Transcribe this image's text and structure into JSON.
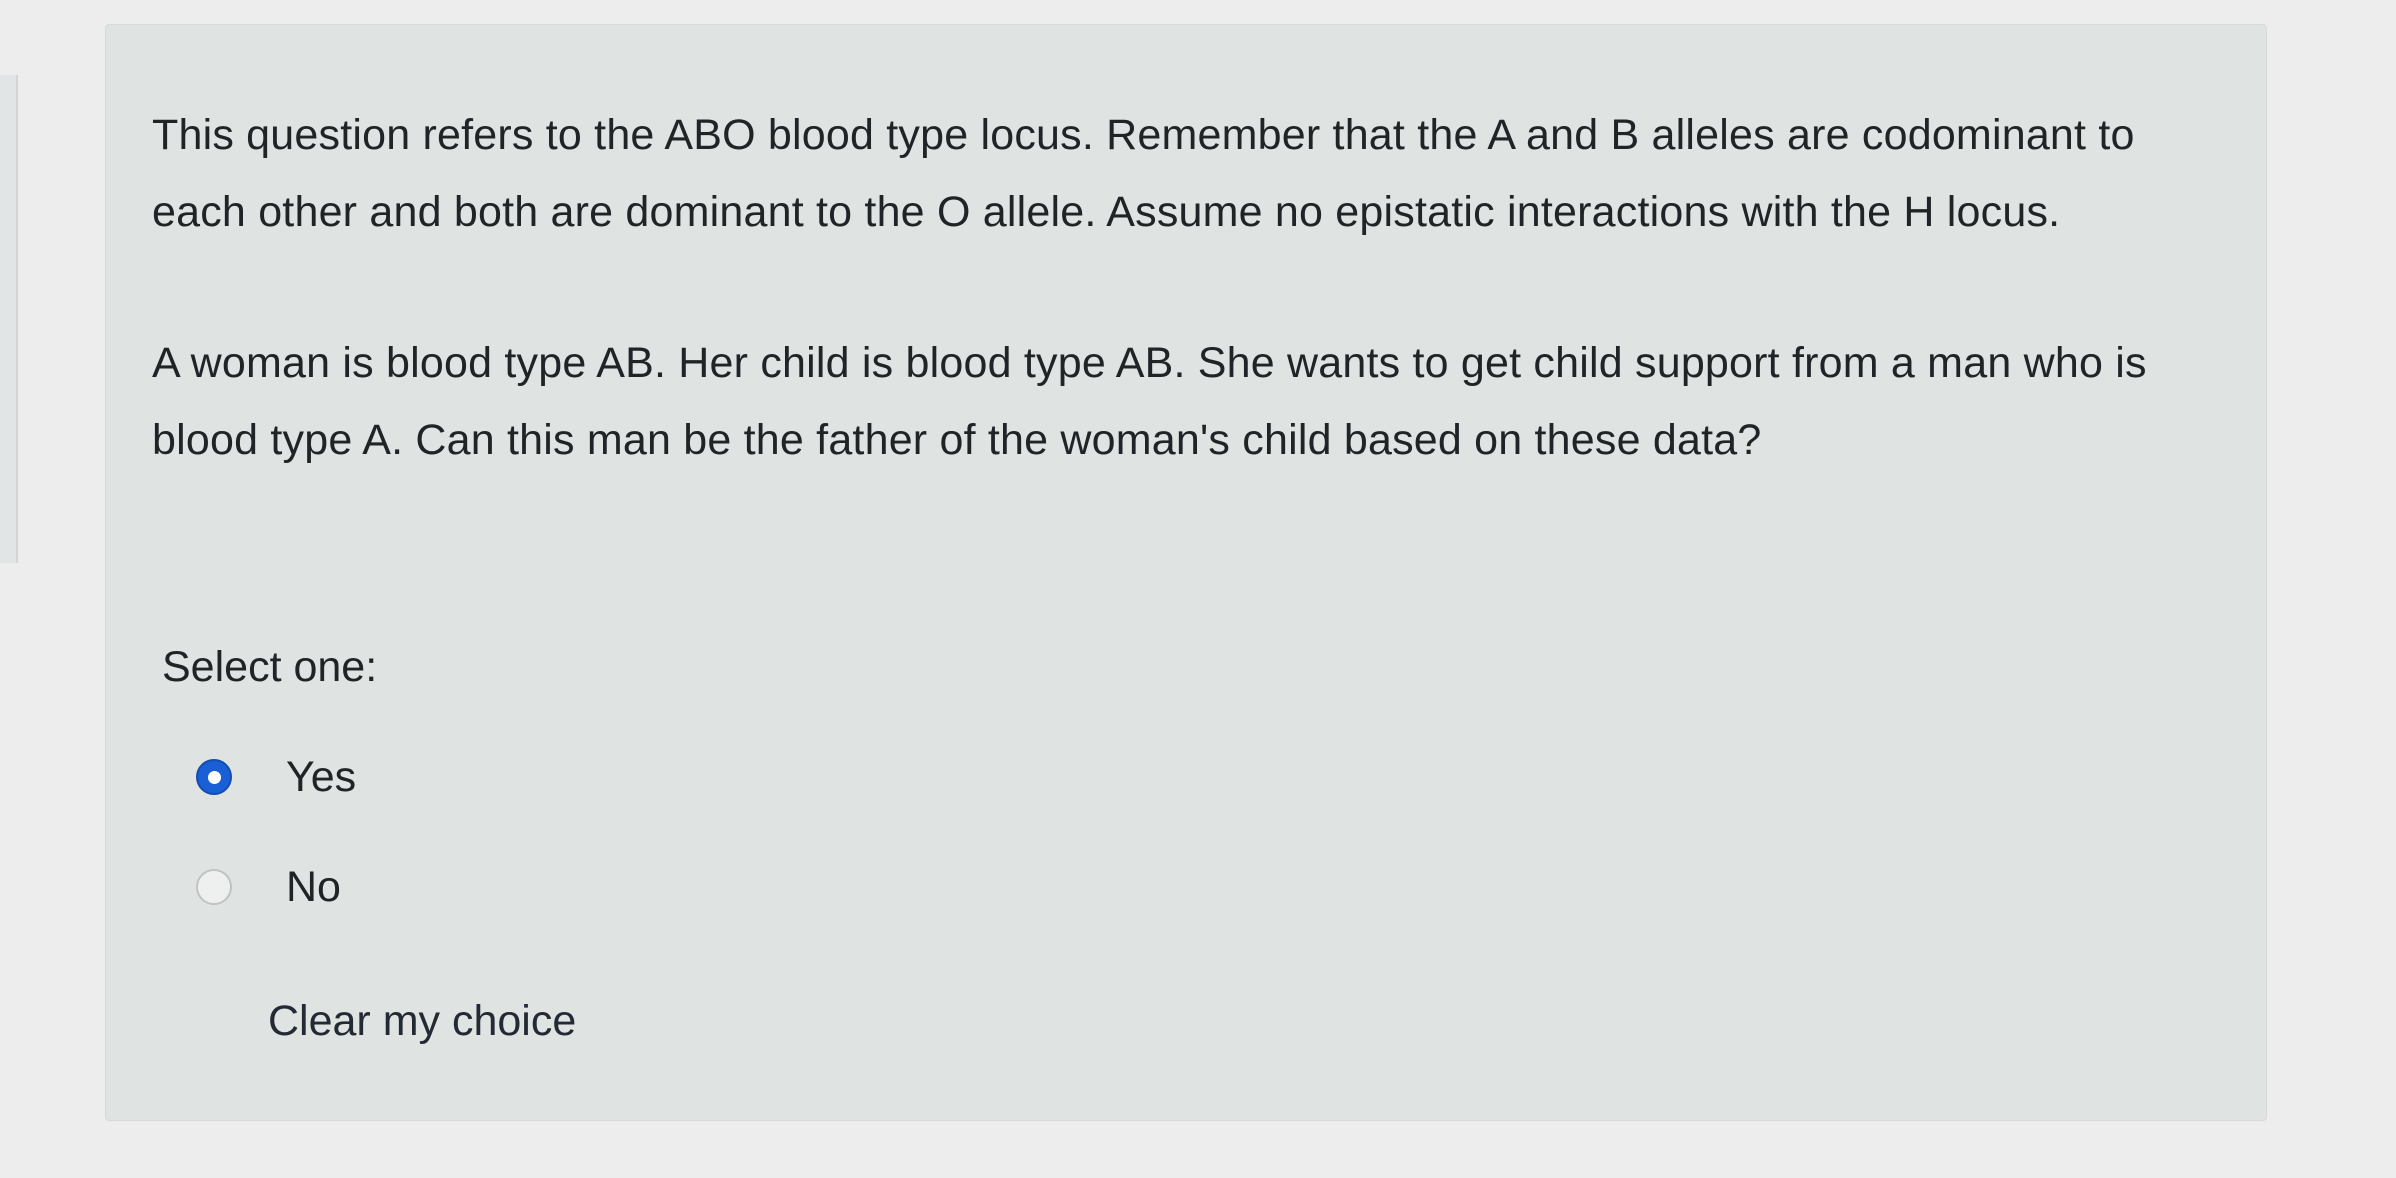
{
  "question": {
    "paragraphs": [
      "This question refers to the ABO blood type locus. Remember that the A and B alleles are codominant to each other and both are dominant to the O allele.  Assume no epistatic interactions with the H locus.",
      "A woman is blood type AB. Her child is blood type AB. She wants to get child support from a man who is blood type A. Can this man be the father of the woman's child based on these data?"
    ],
    "prompt": "Select one:",
    "options": [
      {
        "label": "Yes",
        "selected": true
      },
      {
        "label": "No",
        "selected": false
      }
    ],
    "clear_label": "Clear my choice"
  },
  "colors": {
    "card_background": "#dfe3e2",
    "radio_selected": "#1a5fd6"
  },
  "icons": {
    "selected_radio": "radio-checked-icon",
    "unselected_radio": "radio-unchecked-icon"
  }
}
